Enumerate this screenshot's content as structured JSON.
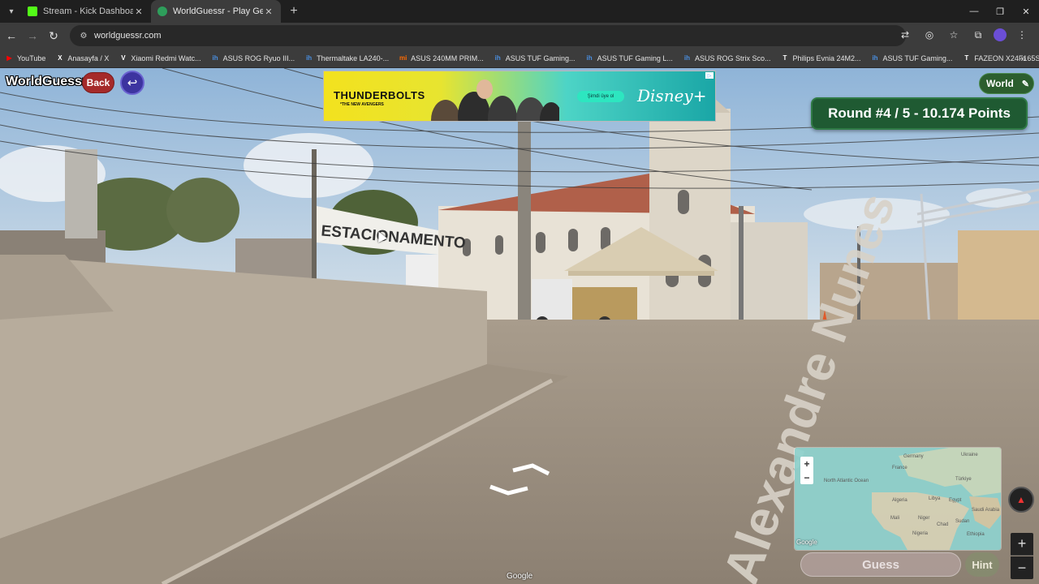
{
  "browser": {
    "tabs": [
      {
        "title": "Stream - Kick Dashboard",
        "favicon_color": "#53fc18",
        "active": false
      },
      {
        "title": "WorldGuessr - Play Geoguessr",
        "favicon_color": "#2e9e5b",
        "active": true
      }
    ],
    "url": "worldguessr.com",
    "bookmarks": [
      {
        "label": "YouTube",
        "icon": "youtube-icon",
        "color": "#ff0000"
      },
      {
        "label": "Anasayfa / X",
        "icon": "x-icon",
        "color": "#ffffff"
      },
      {
        "label": "Xiaomi Redmi Watc...",
        "icon": "v-icon",
        "color": "#ffffff"
      },
      {
        "label": "ASUS ROG Ryuo III...",
        "icon": "ih-icon",
        "color": "#4a90e2"
      },
      {
        "label": "Thermaltake LA240-...",
        "icon": "ih-icon",
        "color": "#4a90e2"
      },
      {
        "label": "ASUS 240MM PRIM...",
        "icon": "mi-icon",
        "color": "#ff6a00"
      },
      {
        "label": "ASUS TUF Gaming...",
        "icon": "ih-icon",
        "color": "#4a90e2"
      },
      {
        "label": "ASUS TUF Gaming L...",
        "icon": "ih-icon",
        "color": "#4a90e2"
      },
      {
        "label": "ASUS ROG Strix Sco...",
        "icon": "ih-icon",
        "color": "#4a90e2"
      },
      {
        "label": "Philips Evnia 24M2...",
        "icon": "t-icon",
        "color": "#ffffff"
      },
      {
        "label": "ASUS TUF Gaming...",
        "icon": "ih-icon",
        "color": "#4a90e2"
      },
      {
        "label": "FAZEON X24F165S...",
        "icon": "t-icon",
        "color": "#ffffff"
      }
    ]
  },
  "game": {
    "logo": "WorldGuessr",
    "back_label": "Back",
    "mode_label": "World",
    "round_text": "Round #4 / 5 - 10.174 Points",
    "guess_label": "Guess",
    "hint_label": "Hint",
    "google_mark": "Google",
    "street_sign": "Alexandre Nunes",
    "banner_text": "ESTACIONAMENTO",
    "colors": {
      "back": "#a52a2a",
      "banner": "#1f5a32",
      "world": "#2c5e2e"
    }
  },
  "ad": {
    "title": "THUNDERBOLTS",
    "subtitle": "*THE NEW AVENGERS",
    "cta": "Şimdi üye ol",
    "brand": "Disney+"
  },
  "minimap": {
    "labels": [
      "North Atlantic Ocean",
      "Germany",
      "Ukraine",
      "France",
      "Türkiye",
      "Algeria",
      "Libya",
      "Egypt",
      "Saudi Arabia",
      "Mali",
      "Niger",
      "Chad",
      "Sudan",
      "Nigeria",
      "Ethiopia"
    ],
    "attribution": "Google"
  }
}
